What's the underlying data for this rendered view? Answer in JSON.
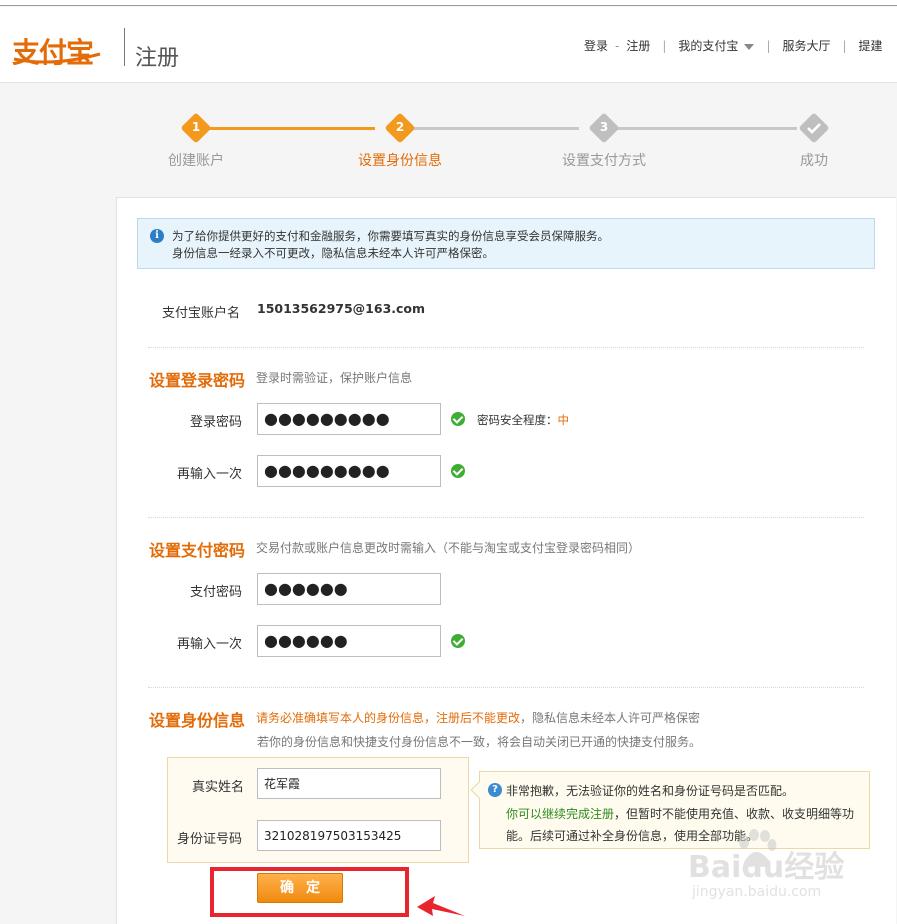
{
  "header": {
    "logo_text": "支付宝",
    "page_title": "注册",
    "nav": {
      "login": "登录",
      "sep": "-",
      "register": "注册",
      "my_alipay": "我的支付宝",
      "service_hall": "服务大厅",
      "suggest": "提建"
    }
  },
  "steps": [
    {
      "num": "1",
      "label": "创建账户",
      "state": "done"
    },
    {
      "num": "2",
      "label": "设置身份信息",
      "state": "active"
    },
    {
      "num": "3",
      "label": "设置支付方式",
      "state": "todo"
    },
    {
      "num": "",
      "label": "成功",
      "state": "todo"
    }
  ],
  "colors": {
    "accent": "#e36c09",
    "step_active": "#f39a1e",
    "step_inactive": "#bfbfbf",
    "ok_green": "#3fad34",
    "highlight_frame": "#e8252c"
  },
  "notice": {
    "line1": "为了给你提供更好的支付和金融服务，你需要填写真实的身份信息享受会员保障服务。",
    "line2": "身份信息一经录入不可更改，隐私信息未经本人许可严格保密。"
  },
  "account": {
    "label": "支付宝账户名",
    "value": "15013562975@163.com"
  },
  "login_password": {
    "title": "设置登录密码",
    "note": "登录时需验证，保护账户信息",
    "pw_label": "登录密码",
    "pw_value": "●●●●●●●●●",
    "confirm_label": "再输入一次",
    "confirm_value": "●●●●●●●●●",
    "strength_label": "密码安全程度：",
    "strength_level": "中"
  },
  "pay_password": {
    "title": "设置支付密码",
    "note": "交易付款或账户信息更改时需输入（不能与淘宝或支付宝登录密码相同）",
    "pw_label": "支付密码",
    "pw_value": "●●●●●●",
    "confirm_label": "再输入一次",
    "confirm_value": "●●●●●●"
  },
  "identity": {
    "title": "设置身份信息",
    "note_red": "请务必准确填写本人的身份信息，注册后不能更改",
    "note_rest": "，隐私信息未经本人许可严格保密",
    "note2": "若你的身份信息和快捷支付身份信息不一致，将会自动关闭已开通的快捷支付服务。",
    "name_label": "真实姓名",
    "name_value": "花军霞",
    "id_label": "身份证号码",
    "id_value": "321028197503153425"
  },
  "tip": {
    "line1": "非常抱歉，无法验证你的姓名和身份证号码是否匹配。",
    "line2_green": "你可以继续完成注册",
    "line2_rest": "，但暂时不能使用充值、收款、收支明细等功",
    "line3": "能。后续可通过补全身份信息，使用全部功能。"
  },
  "confirm_button": "确定",
  "watermark": {
    "brand": "Baidu经验",
    "url": "jingyan.baidu.com"
  }
}
